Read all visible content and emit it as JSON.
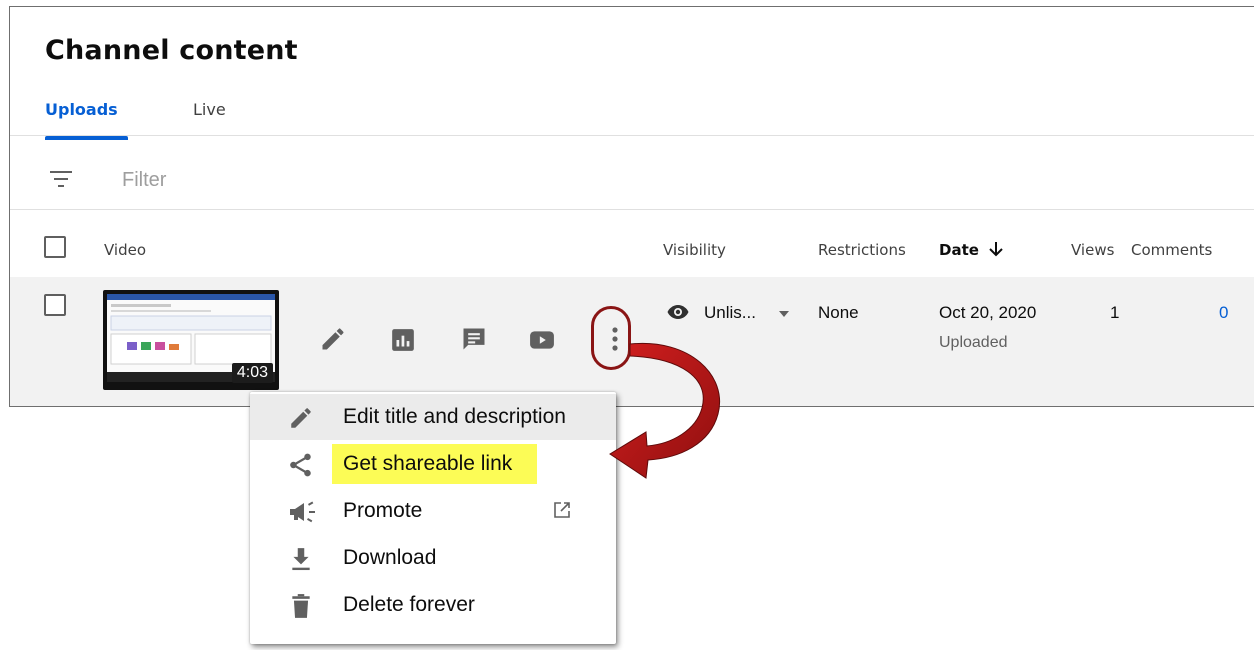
{
  "page": {
    "title": "Channel content"
  },
  "tabs": [
    {
      "label": "Uploads",
      "active": true
    },
    {
      "label": "Live",
      "active": false
    }
  ],
  "filter": {
    "placeholder": "Filter",
    "icon": "filter-icon"
  },
  "columns": {
    "video": "Video",
    "visibility": "Visibility",
    "restrictions": "Restrictions",
    "date": "Date",
    "views": "Views",
    "comments": "Comments"
  },
  "row": {
    "duration": "4:03",
    "visibility": "Unlis...",
    "restrictions": "None",
    "date": "Oct 20, 2020",
    "date_status": "Uploaded",
    "views": "1",
    "comments": "0",
    "actions": [
      "edit-icon",
      "analytics-icon",
      "comments-icon",
      "youtube-icon",
      "more-vert-icon"
    ]
  },
  "menu": {
    "items": [
      {
        "label": "Edit title and description",
        "icon": "pencil-icon"
      },
      {
        "label": "Get shareable link",
        "icon": "share-icon"
      },
      {
        "label": "Promote",
        "icon": "megaphone-icon"
      },
      {
        "label": "Download",
        "icon": "download-icon"
      },
      {
        "label": "Delete forever",
        "icon": "trash-icon"
      }
    ]
  },
  "colors": {
    "accent": "#065fd4",
    "highlight": "#fcfc56",
    "annotation": "#b01818",
    "row_bg": "#f2f2f2"
  }
}
